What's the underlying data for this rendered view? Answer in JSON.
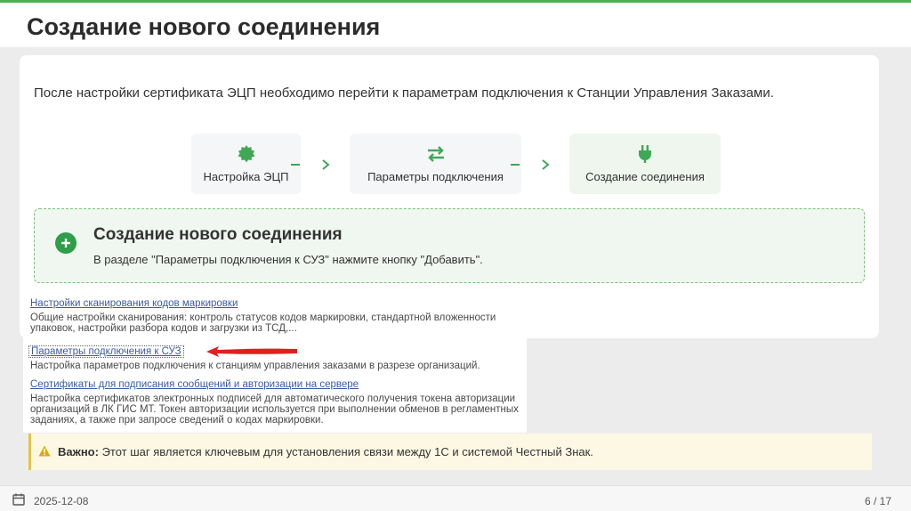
{
  "slide": {
    "title": "Создание нового соединения",
    "intro": "После настройки сертификата ЭЦП необходимо перейти к параметрам подключения к Станции Управления Заказами."
  },
  "steps": [
    {
      "label": "Настройка ЭЦП",
      "icon": "certificate-badge-icon"
    },
    {
      "label": "Параметры подключения",
      "icon": "exchange-arrows-icon"
    },
    {
      "label": "Создание соединения",
      "icon": "plug-icon",
      "active": true
    }
  ],
  "callout": {
    "title": "Создание нового соединения",
    "text": "В разделе \"Параметры подключения к СУЗ\" нажмите кнопку \"Добавить\"."
  },
  "screenshot": {
    "items": [
      {
        "link": "Настройки сканирования кодов маркировки",
        "desc": "Общие настройки сканирования: контроль статусов кодов маркировки, стандартной вложенности упаковок, настройки разбора кодов и загрузки из ТСД,..."
      },
      {
        "link": "Параметры подключения к СУЗ",
        "desc": "Настройка параметров подключения к станциям управления заказами в разрезе организаций."
      },
      {
        "link": "Сертификаты для подписания сообщений и авторизации на сервере",
        "desc": "Настройка сертификатов электронных подписей для автоматического получения токена авторизации организаций в ЛК ГИС МТ. Токен авторизации используется при выполнении обменов в регламентных заданиях, а также при запросе сведений о кодах маркировки."
      }
    ]
  },
  "warning": {
    "label": "Важно:",
    "text": " Этот шаг является ключевым для установления связи между 1С и системой Честный Знак."
  },
  "footer": {
    "date": "2025-12-08",
    "page": "6 / 17"
  },
  "colors": {
    "accent": "#4caf50",
    "callout_bg": "#f0f7f0",
    "warning_bg": "#fdf8e4",
    "arrow": "#e02020"
  }
}
